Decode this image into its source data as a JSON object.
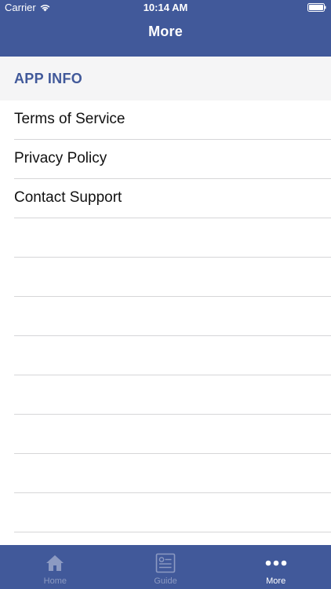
{
  "status_bar": {
    "carrier": "Carrier",
    "time": "10:14 AM"
  },
  "nav": {
    "title": "More"
  },
  "section": {
    "title": "APP INFO"
  },
  "menu_items": [
    "Terms of Service",
    "Privacy Policy",
    "Contact Support"
  ],
  "tabs": [
    {
      "label": "Home",
      "icon": "home-icon",
      "active": false
    },
    {
      "label": "Guide",
      "icon": "guide-icon",
      "active": false
    },
    {
      "label": "More",
      "icon": "more-dots-icon",
      "active": true
    }
  ],
  "colors": {
    "primary": "#41599a",
    "section_bg": "#f5f5f6",
    "tab_inactive": "#8c9ac2",
    "tab_active": "#ffffff",
    "separator": "#d6d6d8"
  }
}
